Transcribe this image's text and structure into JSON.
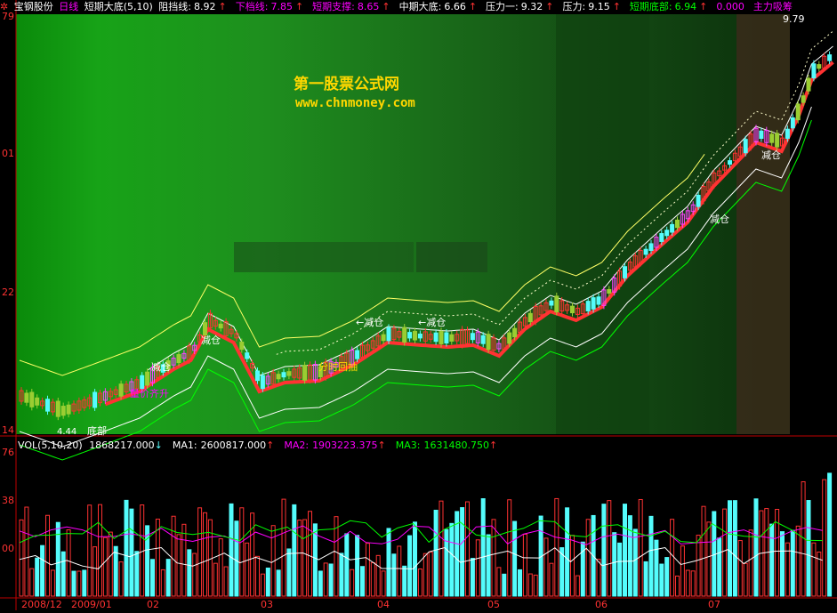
{
  "header": {
    "app_icon": "gear-icon",
    "stock_name": "宝钢股份",
    "period": "日线",
    "indicator": "短期大底(5,10)",
    "resist_label": "阻挡线:",
    "resist_value": "8.92",
    "lower_gear_label": "下档线:",
    "lower_gear_value": "7.85",
    "short_support_label": "短期支撑:",
    "short_support_value": "8.65",
    "mid_bottom_label": "中期大底:",
    "mid_bottom_value": "6.66",
    "pressure1_label": "压力一:",
    "pressure1_value": "9.32",
    "pressure_label": "压力:",
    "pressure_value": "9.15",
    "short_bottom_label": "短期底部:",
    "short_bottom_value": "6.94",
    "zero_value": "0.000",
    "main_force_label": "主力吸筹"
  },
  "price_axis": [
    "79",
    "01",
    "22",
    "14"
  ],
  "price_top_label": "9.79",
  "price_bottom_label": "4.44",
  "watermark": {
    "line1": "第一股票公式网",
    "line2": "www.chnmoney.com"
  },
  "signals": {
    "reduce": "减仓",
    "reduce_arrow": "←减仓",
    "volume_rise": "量价齐升",
    "divergence": "分时回抽",
    "bottom": "底部"
  },
  "vol_header": {
    "title": "VOL(5,10,20)",
    "vol_value": "1868217.000",
    "ma1_label": "MA1:",
    "ma1_value": "2600817.000",
    "ma2_label": "MA2:",
    "ma2_value": "1903223.375",
    "ma3_label": "MA3:",
    "ma3_value": "1631480.750"
  },
  "vol_axis": [
    "76",
    "38",
    "00"
  ],
  "date_axis": [
    "2008/12",
    "2009/01",
    "02",
    "03",
    "04",
    "05",
    "06",
    "07"
  ],
  "colors": {
    "rise": "#ff3232",
    "fall": "#54fcfc",
    "ma1": "#ffffff",
    "ma2": "#ff00ff",
    "ma3": "#00ff00",
    "header_white": "#ffffff",
    "header_magenta": "#ff00ff",
    "header_green": "#00ff00"
  }
}
